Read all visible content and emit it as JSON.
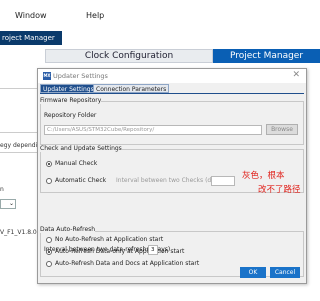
{
  "menubar": {
    "window_label": "Window",
    "help_label": "Help"
  },
  "breadcrumb": "roject Manager",
  "tabs_main": {
    "clock": "Clock Configuration",
    "project": "Project Manager"
  },
  "left_panel": {
    "text1": "egy depending",
    "text2": "n",
    "text3": "V_F1_V1.8.0"
  },
  "dialog": {
    "title": "Updater Settings",
    "tabs": [
      "Updater Settings",
      "Connection Parameters"
    ],
    "firmware_repository": {
      "title": "Firmware Repository",
      "folder_label": "Repository Folder",
      "folder_value": "C:/Users/ASUS/STM32Cube/Repository/",
      "browse_label": "Browse"
    },
    "check_update": {
      "title": "Check and Update Settings",
      "manual_label": "Manual Check",
      "automatic_label": "Automatic Check",
      "interval_label": "Interval between two Checks (days)",
      "selected": "manual"
    },
    "auto_refresh": {
      "title": "Data Auto-Refresh",
      "options": [
        "No Auto-Refresh at Application start",
        "Auto-Refresh Data-only at Application start",
        "Auto-Refresh Data and Docs at Application start"
      ],
      "selected_index": 1,
      "interval_label": "Interval between two data-refreshs (days)",
      "interval_value": "3"
    },
    "ok_label": "OK",
    "cancel_label": "Cancel"
  },
  "annotation": {
    "line1": "灰色，根本",
    "line2": "改不了路径",
    "color": "#e0201a"
  },
  "colors": {
    "accent": "#0a5fb4",
    "dialog_button": "#1a73c9",
    "active_tab": "#1f4e8c"
  }
}
